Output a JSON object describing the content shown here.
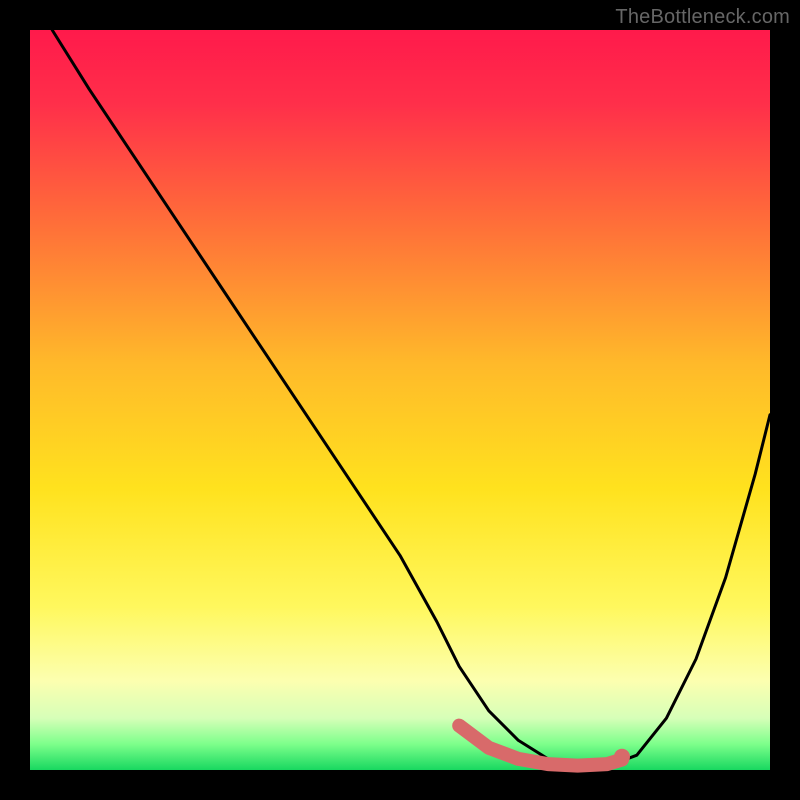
{
  "attribution": "TheBottleneck.com",
  "gradient_stops": [
    {
      "offset": 0.0,
      "color": "#ff1a4b"
    },
    {
      "offset": 0.1,
      "color": "#ff2f4a"
    },
    {
      "offset": 0.25,
      "color": "#ff6a3a"
    },
    {
      "offset": 0.45,
      "color": "#ffb92a"
    },
    {
      "offset": 0.62,
      "color": "#ffe21e"
    },
    {
      "offset": 0.78,
      "color": "#fff85e"
    },
    {
      "offset": 0.88,
      "color": "#fcffb0"
    },
    {
      "offset": 0.93,
      "color": "#d6ffb8"
    },
    {
      "offset": 0.965,
      "color": "#7dff8b"
    },
    {
      "offset": 1.0,
      "color": "#18d860"
    }
  ],
  "chart_data": {
    "type": "line",
    "title": "",
    "xlabel": "",
    "ylabel": "",
    "xlim": [
      0,
      100
    ],
    "ylim": [
      0,
      100
    ],
    "grid": false,
    "legend": false,
    "series": [
      {
        "name": "bottleneck-curve",
        "color": "#000000",
        "x": [
          3,
          8,
          14,
          20,
          26,
          32,
          38,
          44,
          50,
          55,
          58,
          62,
          66,
          70,
          74,
          78,
          82,
          86,
          90,
          94,
          98,
          100
        ],
        "y": [
          100,
          92,
          83,
          74,
          65,
          56,
          47,
          38,
          29,
          20,
          14,
          8,
          4,
          1.5,
          0.5,
          0.5,
          2,
          7,
          15,
          26,
          40,
          48
        ]
      }
    ],
    "highlight": {
      "name": "optimal-range",
      "color": "#d86a6a",
      "x": [
        58,
        62,
        66,
        70,
        74,
        78,
        80
      ],
      "y": [
        6,
        3,
        1.5,
        0.8,
        0.6,
        0.8,
        1.4
      ],
      "endpoint": {
        "x": 80,
        "y": 1.8
      }
    }
  }
}
